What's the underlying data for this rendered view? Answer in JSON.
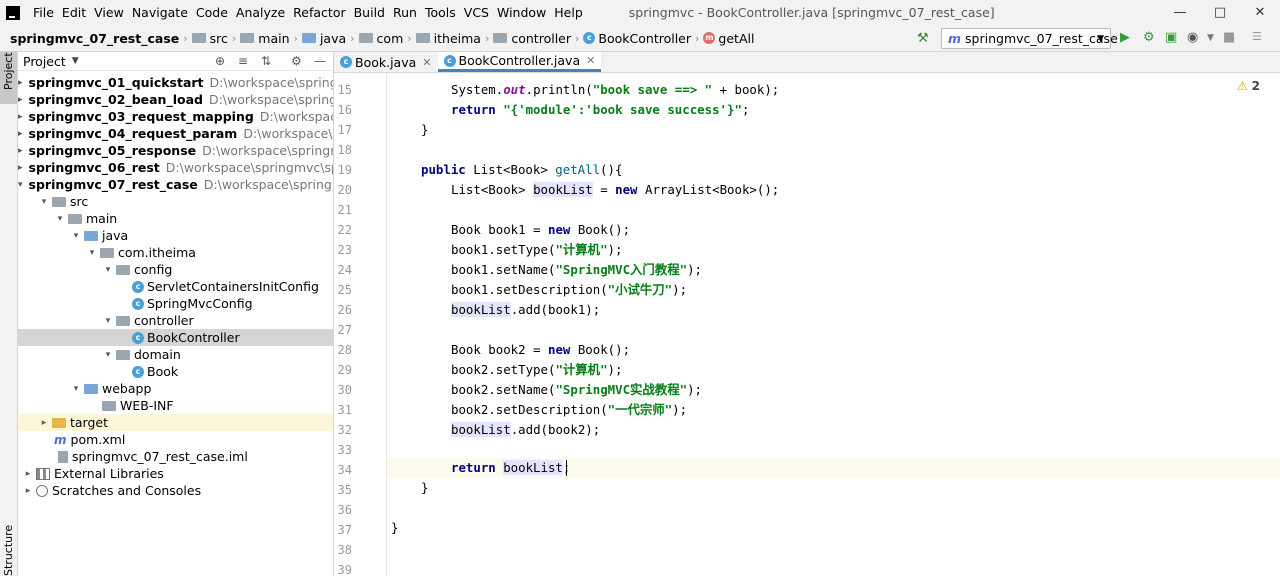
{
  "menubar": {
    "items": [
      "File",
      "Edit",
      "View",
      "Navigate",
      "Code",
      "Analyze",
      "Refactor",
      "Build",
      "Run",
      "Tools",
      "VCS",
      "Window",
      "Help"
    ],
    "title": "springmvc - BookController.java [springmvc_07_rest_case]"
  },
  "navbar": {
    "crumbs": [
      "springmvc_07_rest_case",
      "src",
      "main",
      "java",
      "com",
      "itheima",
      "controller",
      "BookController",
      "getAll"
    ],
    "run_config": "springmvc_07_rest_case"
  },
  "project": {
    "header": "Project",
    "side_tab": "Project",
    "structure_tab": "Structure",
    "tree": [
      {
        "label": "springmvc_01_quickstart",
        "path": "D:\\workspace\\springmvc\\"
      },
      {
        "label": "springmvc_02_bean_load",
        "path": "D:\\workspace\\springmvc\\"
      },
      {
        "label": "springmvc_03_request_mapping",
        "path": "D:\\workspace\\spri"
      },
      {
        "label": "springmvc_04_request_param",
        "path": "D:\\workspace\\spring"
      },
      {
        "label": "springmvc_05_response",
        "path": "D:\\workspace\\springmvc\\s"
      },
      {
        "label": "springmvc_06_rest",
        "path": "D:\\workspace\\springmvc\\springr"
      },
      {
        "label": "springmvc_07_rest_case",
        "path": "D:\\workspace\\springmvc\\s"
      },
      {
        "label": "src"
      },
      {
        "label": "main"
      },
      {
        "label": "java"
      },
      {
        "label": "com.itheima"
      },
      {
        "label": "config"
      },
      {
        "label": "ServletContainersInitConfig"
      },
      {
        "label": "SpringMvcConfig"
      },
      {
        "label": "controller"
      },
      {
        "label": "BookController"
      },
      {
        "label": "domain"
      },
      {
        "label": "Book"
      },
      {
        "label": "webapp"
      },
      {
        "label": "WEB-INF"
      },
      {
        "label": "target"
      },
      {
        "label": "pom.xml"
      },
      {
        "label": "springmvc_07_rest_case.iml"
      },
      {
        "label": "External Libraries"
      },
      {
        "label": "Scratches and Consoles"
      }
    ]
  },
  "tabs": [
    {
      "label": "Book.java"
    },
    {
      "label": "BookController.java"
    }
  ],
  "editor": {
    "warnings": "2",
    "line_numbers": [
      "15",
      "16",
      "17",
      "18",
      "19",
      "20",
      "21",
      "22",
      "23",
      "24",
      "25",
      "26",
      "27",
      "28",
      "29",
      "30",
      "31",
      "32",
      "33",
      "34",
      "35",
      "36",
      "37",
      "38",
      "39"
    ],
    "lines": {
      "l15a": "System.",
      "l15b": "out",
      "l15c": ".println(",
      "l15d": "\"book save ==> \"",
      "l15e": "+ book);",
      "l16a": "return ",
      "l16b": "\"{'module':'book save success'}\"",
      "l16c": ";",
      "l17": "}",
      "l19a": "public ",
      "l19b": "List<Book> ",
      "l19c": "getAll",
      "l19d": "(){",
      "l20a": "List<Book> ",
      "l20b": "bookList",
      "l20c": " = ",
      "l20d": "new ",
      "l20e": "ArrayList<Book>();",
      "l22a": "Book book1 = ",
      "l22b": "new ",
      "l22c": "Book();",
      "l23a": "book1.setType(",
      "l23b": "\"计算机\"",
      "l23c": ");",
      "l24a": "book1.setName(",
      "l24b": "\"SpringMVC入门教程\"",
      "l24c": ");",
      "l25a": "book1.setDescription(",
      "l25b": "\"小试牛刀\"",
      "l25c": ");",
      "l26a": "bookList",
      "l26b": ".add(book1);",
      "l28a": "Book book2 = ",
      "l28b": "new ",
      "l28c": "Book();",
      "l29a": "book2.setType(",
      "l29b": "\"计算机\"",
      "l29c": ");",
      "l30a": "book2.setName(",
      "l30b": "\"SpringMVC实战教程\"",
      "l30c": ");",
      "l31a": "book2.setDescription(",
      "l31b": "\"一代宗师\"",
      "l31c": ");",
      "l32a": "bookList",
      "l32b": ".add(book2);",
      "l34a": "return ",
      "l34b": "bookList",
      "l34c": ";",
      "l35": "}",
      "l37": "}"
    }
  }
}
